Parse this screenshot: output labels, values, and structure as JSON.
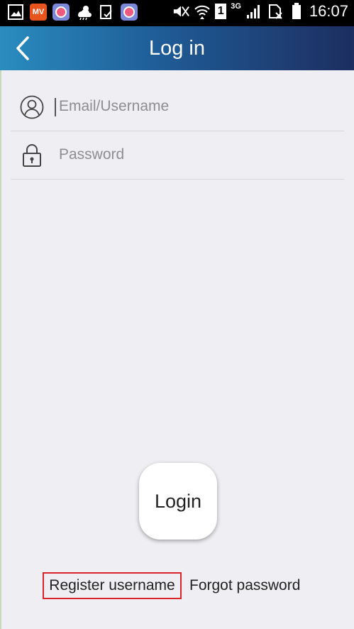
{
  "status_bar": {
    "time": "16:07",
    "network": "3G",
    "sim_slot": "1",
    "left_icons": [
      "image-notification-icon",
      "mv-app-icon",
      "camera-app-icon",
      "weather-icon",
      "clipboard-check-icon",
      "camera-app-icon"
    ],
    "right_icons": [
      "mute-icon",
      "wifi-icon",
      "sim-badge",
      "network-type",
      "signal-icon",
      "no-sim-icon",
      "battery-icon"
    ]
  },
  "header": {
    "title": "Log in",
    "back_icon": "chevron-left-icon",
    "gradient_start": "#2a8cbf",
    "gradient_end": "#1d2e60"
  },
  "form": {
    "email": {
      "placeholder": "Email/Username",
      "value": "",
      "icon": "user-icon"
    },
    "password": {
      "placeholder": "Password",
      "value": "",
      "icon": "lock-icon"
    }
  },
  "actions": {
    "login_label": "Login",
    "register_label": "Register username",
    "forgot_label": "Forgot password",
    "highlight_color": "#d9232d"
  }
}
